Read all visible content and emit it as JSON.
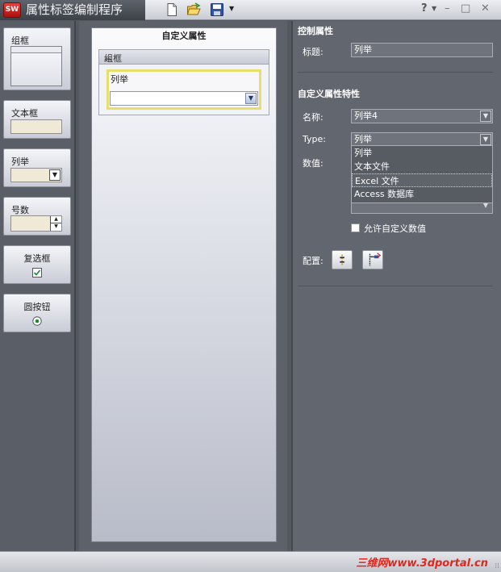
{
  "window": {
    "logo_text": "SW",
    "title": "属性标签编制程序",
    "help_label": "?",
    "minimize_label": "–",
    "maximize_label": "□",
    "close_label": "✕"
  },
  "toolbar": {
    "icons": [
      "new-document-icon",
      "open-folder-icon",
      "save-icon"
    ]
  },
  "palette": {
    "items": [
      {
        "label": "组框",
        "type": "groupbox"
      },
      {
        "label": "文本框",
        "type": "textbox"
      },
      {
        "label": "列举",
        "type": "list"
      },
      {
        "label": "号数",
        "type": "number"
      },
      {
        "label": "复选框",
        "type": "checkbox"
      },
      {
        "label": "圆按钮",
        "type": "radio"
      }
    ]
  },
  "preview": {
    "title": "自定义属性",
    "group_title": "组框",
    "field_label": "列举",
    "field_value": ""
  },
  "properties": {
    "control_section": "控制属性",
    "caption_label": "标题:",
    "caption_value": "列举",
    "custom_section": "自定义属性特性",
    "name_label": "名称:",
    "name_value": "列举4",
    "type_label": "Type:",
    "type_value": "列举",
    "type_options": [
      "列举",
      "文本文件",
      "Excel 文件",
      "Access 数据库"
    ],
    "type_highlighted_index": 2,
    "values_label": "数值:",
    "allow_custom_label": "允许自定义数值",
    "allow_custom_checked": false,
    "config_label": "配置:"
  },
  "status": {
    "watermark": "三维网www.3dportal.cn"
  },
  "colors": {
    "accent_selection": "#e8df6a",
    "panel_dark": "#62666e",
    "brand_red": "#e1261c"
  }
}
